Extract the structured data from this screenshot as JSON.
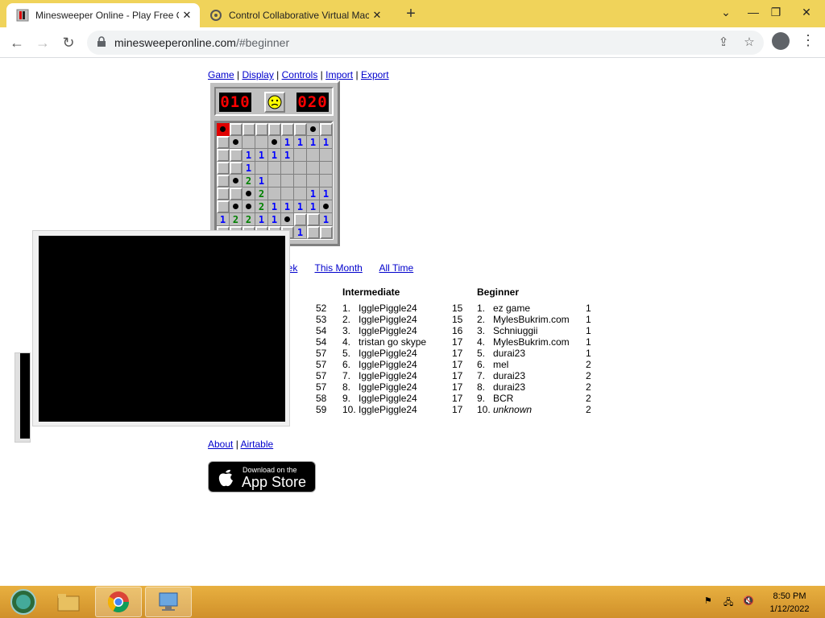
{
  "tabs": [
    {
      "title": "Minesweeper Online - Play Free Onl",
      "icon": "minesweeper-favicon",
      "close": "✕"
    },
    {
      "title": "Control Collaborative Virtual Mac",
      "icon": "vm-favicon",
      "close": "✕"
    }
  ],
  "new_tab": "+",
  "window_controls": {
    "minimize": "⌄",
    "restore": "❐",
    "close": "✕"
  },
  "url": {
    "host": "minesweeperonline.com",
    "path": "/#beginner"
  },
  "top_menu": [
    "Game",
    "Display",
    "Controls",
    "Import",
    "Export"
  ],
  "game": {
    "mines_left": "010",
    "timer": "020",
    "face": "sad-face-icon",
    "board": [
      [
        "x",
        "c",
        "c",
        "c",
        "c",
        "c",
        "c",
        "m",
        "c"
      ],
      [
        "c",
        "m",
        "o",
        "o",
        "m",
        "1",
        "1",
        "1",
        "1"
      ],
      [
        "c",
        "c",
        "1",
        "1",
        "1",
        "1",
        "o",
        "o",
        "o"
      ],
      [
        "c",
        "c",
        "1",
        "o",
        "o",
        "o",
        "o",
        "o",
        "o"
      ],
      [
        "c",
        "m",
        "2",
        "1",
        "o",
        "o",
        "o",
        "o",
        "o"
      ],
      [
        "c",
        "c",
        "m",
        "2",
        "o",
        "o",
        "o",
        "1",
        "1"
      ],
      [
        "c",
        "m",
        "m",
        "2",
        "1",
        "1",
        "1",
        "1",
        "m"
      ],
      [
        "1",
        "2",
        "2",
        "1",
        "1",
        "m",
        "c",
        "c",
        "1"
      ],
      [
        "c",
        "c",
        "c",
        "c",
        "c",
        "c",
        "1",
        "c",
        "c"
      ]
    ]
  },
  "periods": [
    "eek",
    "This Month",
    "All Time"
  ],
  "intermediate": {
    "title": "Intermediate",
    "prev_times": [
      "52",
      "53",
      "54",
      "54",
      "57",
      "57",
      "57",
      "57",
      "58",
      "59"
    ],
    "rows": [
      {
        "rank": "1.",
        "name": "IgglePiggle24",
        "time": "15"
      },
      {
        "rank": "2.",
        "name": "IgglePiggle24",
        "time": "15"
      },
      {
        "rank": "3.",
        "name": "IgglePiggle24",
        "time": "16"
      },
      {
        "rank": "4.",
        "name": "tristan go skype",
        "time": "17"
      },
      {
        "rank": "5.",
        "name": "IgglePiggle24",
        "time": "17"
      },
      {
        "rank": "6.",
        "name": "IgglePiggle24",
        "time": "17"
      },
      {
        "rank": "7.",
        "name": "IgglePiggle24",
        "time": "17"
      },
      {
        "rank": "8.",
        "name": "IgglePiggle24",
        "time": "17"
      },
      {
        "rank": "9.",
        "name": "IgglePiggle24",
        "time": "17"
      },
      {
        "rank": "10.",
        "name": "IgglePiggle24",
        "time": "17"
      }
    ]
  },
  "beginner": {
    "title": "Beginner",
    "rows": [
      {
        "rank": "1.",
        "name": "ez game",
        "time": "1"
      },
      {
        "rank": "2.",
        "name": "MylesBukrim.com",
        "time": "1"
      },
      {
        "rank": "3.",
        "name": "Schniuggii",
        "time": "1"
      },
      {
        "rank": "4.",
        "name": "MylesBukrim.com",
        "time": "1"
      },
      {
        "rank": "5.",
        "name": "durai23",
        "time": "1"
      },
      {
        "rank": "6.",
        "name": "mel",
        "time": "2"
      },
      {
        "rank": "7.",
        "name": "durai23",
        "time": "2"
      },
      {
        "rank": "8.",
        "name": "durai23",
        "time": "2"
      },
      {
        "rank": "9.",
        "name": "BCR",
        "time": "2"
      },
      {
        "rank": "10.",
        "name": "unknown",
        "time": "2",
        "italic": true
      }
    ]
  },
  "footer": {
    "about": "About",
    "airtable": "Airtable"
  },
  "app_store": {
    "small": "Download on the",
    "big": "App Store"
  },
  "clock": {
    "time": "8:50 PM",
    "date": "1/12/2022"
  }
}
